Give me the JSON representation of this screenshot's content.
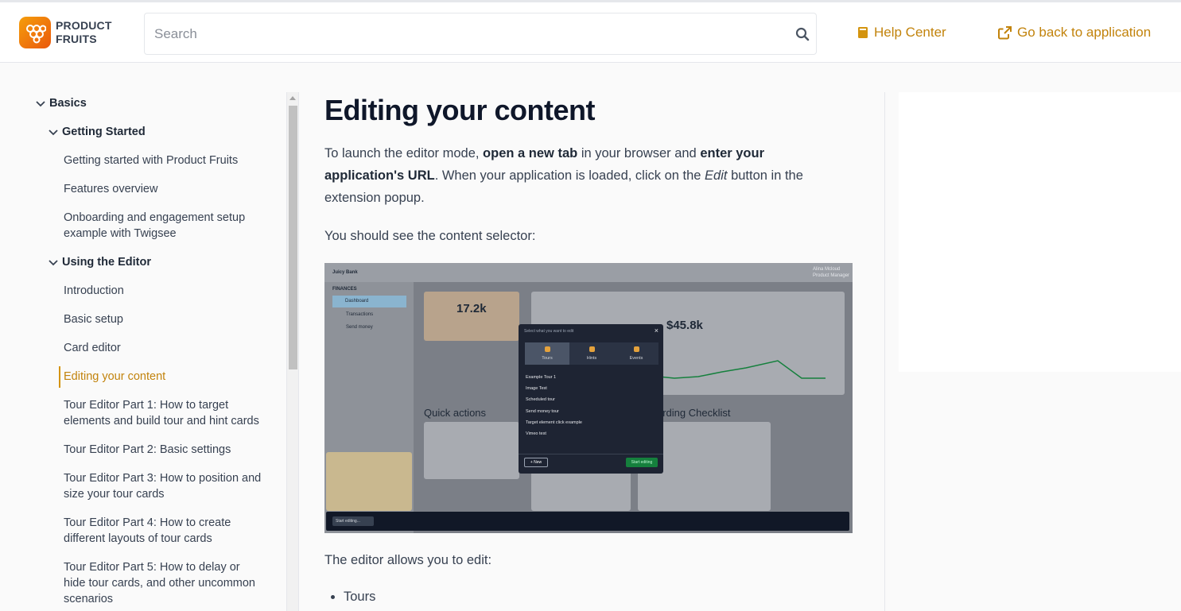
{
  "header": {
    "logo_line1": "PRODUCT",
    "logo_line2": "FRUITS",
    "search_placeholder": "Search",
    "help_center": "Help Center",
    "go_back": "Go back to application"
  },
  "sidebar": {
    "basics": "Basics",
    "getting_started": "Getting Started",
    "items_getting_started": [
      "Getting started with Product Fruits",
      "Features overview",
      "Onboarding and engagement setup",
      "example with Twigsee"
    ],
    "using_editor": "Using the Editor",
    "items_editor": [
      "Introduction",
      "Basic setup",
      "Card editor",
      "Editing your content",
      "Tour Editor Part 1: How to target",
      "elements and build tour and hint cards",
      "Tour Editor Part 2: Basic settings",
      "Tour Editor Part 3: How to position and",
      "size your tour cards",
      "Tour Editor Part 4: How to create",
      "different layouts of tour cards",
      "Tour Editor Part 5: How to delay or",
      "hide tour cards, and other uncommon",
      "scenarios"
    ]
  },
  "article": {
    "title": "Editing your content",
    "p1_a": "To launch the editor mode, ",
    "p1_b": "open a new tab",
    "p1_c": " in your browser and ",
    "p1_d": "enter your application's URL",
    "p1_e": ". When your application is loaded, click on the ",
    "p1_f": "Edit",
    "p1_g": " button in the extension popup.",
    "p2": "You should see the content selector:",
    "p3": "The editor allows you to edit:",
    "bullet1": "Tours"
  },
  "screenshot": {
    "app_name": "Juicy Bank",
    "user_name": "Alina Mcloud",
    "user_role": "Product Manager",
    "nav_section": "FINANCES",
    "nav_items": [
      "Dashboard",
      "Transactions",
      "Send money"
    ],
    "stat1": "17.2k",
    "stat2": "$45.8k",
    "quick_actions": "Quick actions",
    "checklist": "arding Checklist",
    "modal_title": "Select what you want to edit",
    "modal_tabs": [
      "Tours",
      "Hints",
      "Events"
    ],
    "modal_items": [
      "Example Tour 1",
      "Image Test",
      "Scheduled tour",
      "Send money tour",
      "Target element click example",
      "Vimeo test"
    ],
    "new_btn": "+ New",
    "start_btn": "Start editing",
    "bottom_btn": "Start editing..."
  }
}
